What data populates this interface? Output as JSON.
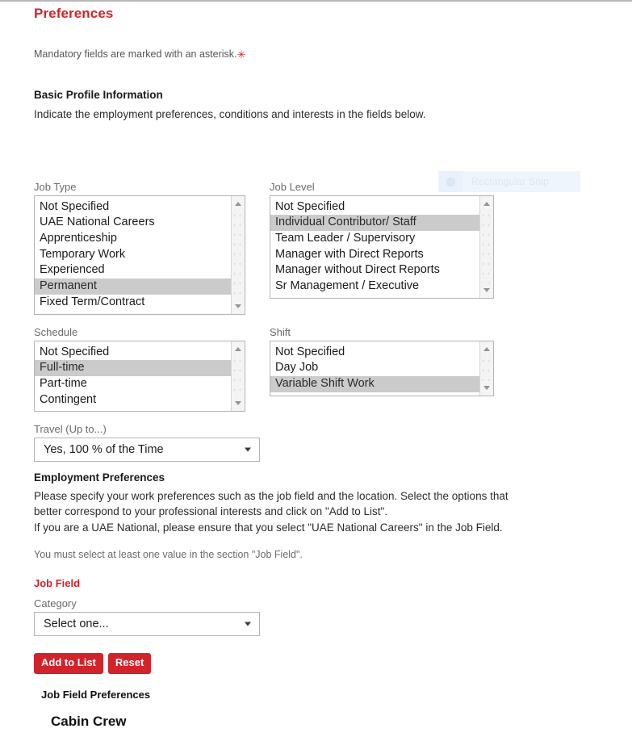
{
  "page": {
    "title": "Preferences",
    "mandatory_note": "Mandatory fields are marked with an asterisk.",
    "mandatory_asterisk": "✳"
  },
  "basic_profile": {
    "heading": "Basic Profile Information",
    "description": "Indicate the employment preferences, conditions and interests in the fields below."
  },
  "fields": {
    "job_type": {
      "label": "Job Type",
      "options": [
        "Not Specified",
        "UAE National Careers",
        "Apprenticeship",
        "Temporary Work",
        "Experienced",
        "Permanent",
        "Fixed Term/Contract"
      ],
      "selected": "Permanent"
    },
    "job_level": {
      "label": "Job Level",
      "options": [
        "Not Specified",
        "Individual Contributor/ Staff",
        "Team Leader / Supervisory",
        "Manager with Direct Reports",
        "Manager without Direct Reports",
        "Sr Management / Executive"
      ],
      "selected": "Individual Contributor/ Staff"
    },
    "schedule": {
      "label": "Schedule",
      "options": [
        "Not Specified",
        "Full-time",
        "Part-time",
        "Contingent"
      ],
      "selected": "Full-time"
    },
    "shift": {
      "label": "Shift",
      "options": [
        "Not Specified",
        "Day Job",
        "Variable Shift Work"
      ],
      "selected": "Variable Shift Work"
    },
    "travel": {
      "label": "Travel (Up to...)",
      "value": "Yes, 100 % of the Time"
    }
  },
  "employment_preferences": {
    "heading": "Employment Preferences",
    "line1": "Please specify your work preferences such as the job field and the location.  Select the options that",
    "line2": "better correspond to your professional interests and click on \"Add to List\".",
    "line3": "If you are a UAE National, please ensure that you select \"UAE National Careers\" in the Job Field.",
    "note": "You must select at least one value in the section \"Job Field\".",
    "job_field_label": "Job Field",
    "category_label": "Category",
    "category_value": "Select one...",
    "add_to_list_button": "Add to List",
    "reset_button": "Reset",
    "job_field_preferences_heading": "Job Field Preferences",
    "job_field_preference_item": "Cabin Crew"
  },
  "snip_overlay": {
    "label": "Rectangular Snip",
    "icon": "camera-icon"
  },
  "colors": {
    "brand_red": "#d2232a",
    "selection_gray": "#cbcbcb",
    "border_gray": "#b4b4b4",
    "label_gray": "#6b6b6b"
  }
}
